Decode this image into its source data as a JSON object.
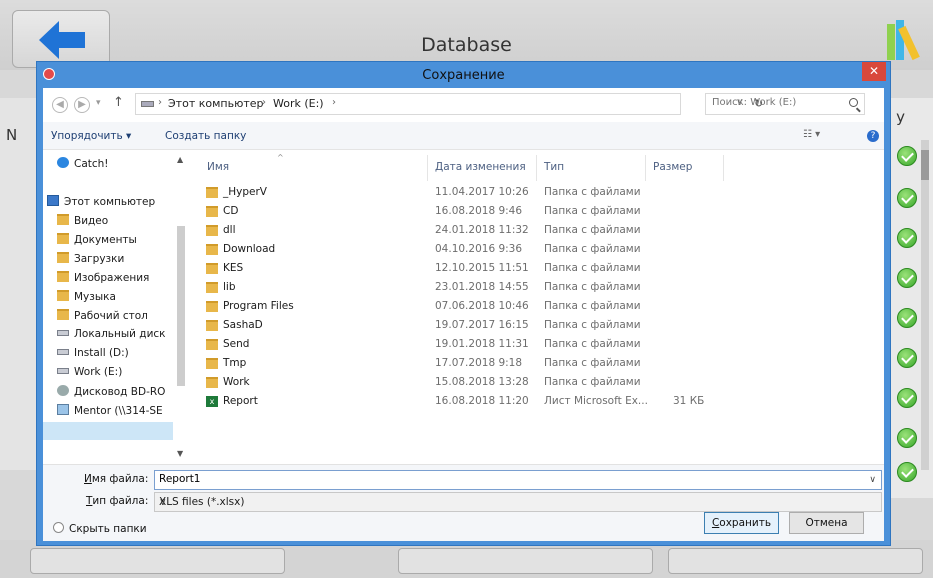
{
  "background_app": {
    "title": "Database",
    "left_letter": "N",
    "right_letter": "y"
  },
  "dialog": {
    "title": "Сохранение",
    "close_label": "✕",
    "address": {
      "segments": [
        "Этот компьютер",
        "Work (E:)"
      ],
      "search_placeholder": "Поиск: Work (E:)"
    },
    "toolbar": {
      "organize": "Упорядочить ▾",
      "new_folder": "Создать папку",
      "view": "☷ ▾",
      "help": "?"
    },
    "nav_pane": [
      {
        "label": "Catch!",
        "icon": "catch-icon"
      },
      {
        "label": "Этот компьютер",
        "icon": "computer-icon"
      },
      {
        "label": "Видео",
        "icon": "folder-icon"
      },
      {
        "label": "Документы",
        "icon": "folder-icon"
      },
      {
        "label": "Загрузки",
        "icon": "folder-icon"
      },
      {
        "label": "Изображения",
        "icon": "folder-icon"
      },
      {
        "label": "Музыка",
        "icon": "folder-icon"
      },
      {
        "label": "Рабочий стол",
        "icon": "folder-icon"
      },
      {
        "label": "Локальный диск",
        "icon": "drive-icon"
      },
      {
        "label": "Install (D:)",
        "icon": "drive-icon"
      },
      {
        "label": "Work (E:)",
        "icon": "drive-icon"
      },
      {
        "label": "Дисковод BD-RO",
        "icon": "disc-icon"
      },
      {
        "label": "Mentor (\\\\314-SE",
        "icon": "network-icon"
      }
    ],
    "columns": {
      "name": "Имя",
      "date": "Дата изменения",
      "type": "Тип",
      "size": "Размер"
    },
    "files": [
      {
        "name": "_HyperV",
        "date": "11.04.2017 10:26",
        "type": "Папка с файлами",
        "size": "",
        "icon": "folder"
      },
      {
        "name": "CD",
        "date": "16.08.2018 9:46",
        "type": "Папка с файлами",
        "size": "",
        "icon": "folder"
      },
      {
        "name": "dll",
        "date": "24.01.2018 11:32",
        "type": "Папка с файлами",
        "size": "",
        "icon": "folder"
      },
      {
        "name": "Download",
        "date": "04.10.2016 9:36",
        "type": "Папка с файлами",
        "size": "",
        "icon": "folder"
      },
      {
        "name": "KES",
        "date": "12.10.2015 11:51",
        "type": "Папка с файлами",
        "size": "",
        "icon": "folder"
      },
      {
        "name": "lib",
        "date": "23.01.2018 14:55",
        "type": "Папка с файлами",
        "size": "",
        "icon": "folder"
      },
      {
        "name": "Program Files",
        "date": "07.06.2018 10:46",
        "type": "Папка с файлами",
        "size": "",
        "icon": "folder"
      },
      {
        "name": "SashaD",
        "date": "19.07.2017 16:15",
        "type": "Папка с файлами",
        "size": "",
        "icon": "folder"
      },
      {
        "name": "Send",
        "date": "19.01.2018 11:31",
        "type": "Папка с файлами",
        "size": "",
        "icon": "folder"
      },
      {
        "name": "Tmp",
        "date": "17.07.2018 9:18",
        "type": "Папка с файлами",
        "size": "",
        "icon": "folder"
      },
      {
        "name": "Work",
        "date": "15.08.2018 13:28",
        "type": "Папка с файлами",
        "size": "",
        "icon": "folder"
      },
      {
        "name": "Report",
        "date": "16.08.2018 11:20",
        "type": "Лист Microsoft Ex...",
        "size": "31 КБ",
        "icon": "xls"
      }
    ],
    "filename_label_u": "И",
    "filename_label_rest": "мя файла:",
    "filename_value": "Report1",
    "filetype_label_u": "Т",
    "filetype_label_rest": "ип файла:",
    "filetype_value": "XLS files (*.xlsx)",
    "hide_folders": "Скрыть папки",
    "save_u": "С",
    "save_rest": "охранить",
    "cancel": "Отмена"
  },
  "colors": {
    "title_bar": "#4a90d9",
    "close": "#d9483b",
    "selection": "#cde6f7",
    "check_green": "#38a82a"
  }
}
